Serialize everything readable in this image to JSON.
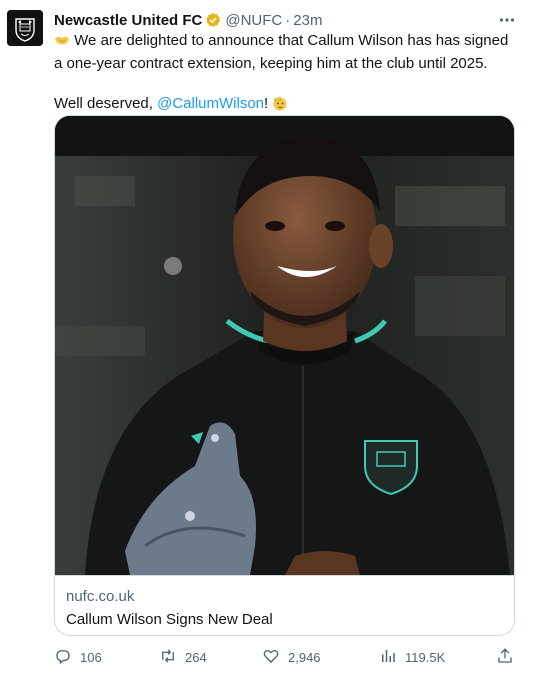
{
  "author": {
    "name": "Newcastle United FC",
    "handle": "@NUFC",
    "separator": "·",
    "time": "23m"
  },
  "tweet": {
    "line1": "We are delighted to announce that Callum Wilson has has signed a one-year contract extension, keeping him at the club until 2025.",
    "line2_prefix": "Well deserved, ",
    "mention": "@CallumWilson",
    "line2_suffix": "!"
  },
  "card": {
    "domain": "nufc.co.uk",
    "title": "Callum Wilson Signs New Deal"
  },
  "actions": {
    "replies": "106",
    "reposts": "264",
    "likes": "2,946",
    "views": "119.5K"
  },
  "icons": {
    "verified": "gold-verified-badge-icon",
    "more": "more-options-icon",
    "reply": "reply-icon",
    "repost": "repost-icon",
    "like": "heart-icon",
    "views": "views-icon",
    "share": "share-icon",
    "handshake": "handshake-emoji-icon",
    "saluting": "saluting-face-emoji-icon"
  },
  "colors": {
    "text": "#0f1419",
    "muted": "#536471",
    "link": "#1d9bf0",
    "border": "#cfd9de",
    "verified_gold": "#e2b719"
  }
}
